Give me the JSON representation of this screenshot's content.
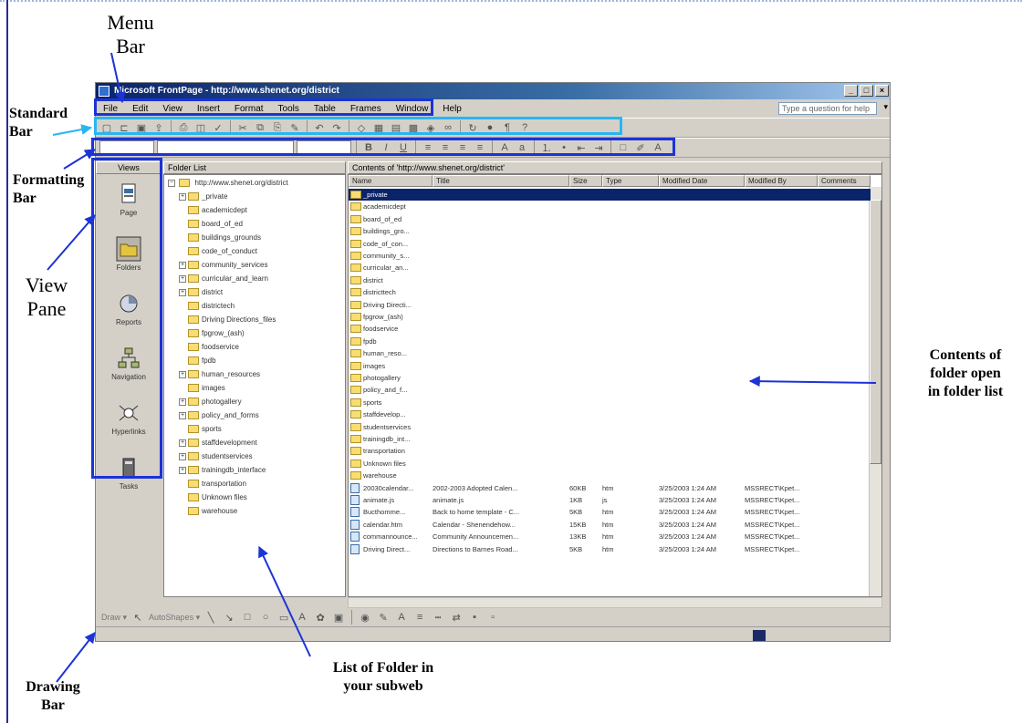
{
  "annotations": {
    "menu_bar": [
      "Menu",
      "Bar"
    ],
    "standard_bar": [
      "Standard",
      "Bar"
    ],
    "formatting_bar": [
      "Formatting",
      "Bar"
    ],
    "view_pane": [
      "View",
      "Pane"
    ],
    "contents": [
      "Contents of",
      "folder open",
      "in folder list"
    ],
    "folder_list": [
      "List of Folder in",
      "your subweb"
    ],
    "drawing_bar": [
      "Drawing",
      "Bar"
    ]
  },
  "window": {
    "title": "Microsoft FrontPage - http://www.shenet.org/district",
    "help_placeholder": "Type a question for help"
  },
  "menu": [
    "File",
    "Edit",
    "View",
    "Insert",
    "Format",
    "Tools",
    "Table",
    "Frames",
    "Window",
    "Help"
  ],
  "headers": {
    "views": "Views",
    "folder_list": "Folder List",
    "contents": "Contents of 'http://www.shenet.org/district'"
  },
  "views": [
    "Page",
    "Folders",
    "Reports",
    "Navigation",
    "Hyperlinks",
    "Tasks"
  ],
  "folder_tree": {
    "root": "http://www.shenet.org/district",
    "items": [
      {
        "name": "_private",
        "expander": true
      },
      {
        "name": "academicdept",
        "expander": false
      },
      {
        "name": "board_of_ed",
        "expander": false
      },
      {
        "name": "buildings_grounds",
        "expander": false
      },
      {
        "name": "code_of_conduct",
        "expander": false
      },
      {
        "name": "community_services",
        "expander": true
      },
      {
        "name": "curricular_and_learn",
        "expander": true
      },
      {
        "name": "district",
        "expander": true
      },
      {
        "name": "districtech",
        "expander": false
      },
      {
        "name": "Driving Directions_files",
        "expander": false
      },
      {
        "name": "fpgrow_(ash)",
        "expander": false
      },
      {
        "name": "foodservice",
        "expander": false
      },
      {
        "name": "fpdb",
        "expander": false
      },
      {
        "name": "human_resources",
        "expander": true
      },
      {
        "name": "images",
        "expander": false
      },
      {
        "name": "photogallery",
        "expander": true
      },
      {
        "name": "policy_and_forms",
        "expander": true
      },
      {
        "name": "sports",
        "expander": false
      },
      {
        "name": "staffdevelopment",
        "expander": true
      },
      {
        "name": "studentservices",
        "expander": true
      },
      {
        "name": "trainingdb_interface",
        "expander": true
      },
      {
        "name": "transportation",
        "expander": false
      },
      {
        "name": "Unknown files",
        "expander": false
      },
      {
        "name": "warehouse",
        "expander": false
      }
    ]
  },
  "contents": {
    "columns": [
      "Name",
      "Title",
      "Size",
      "Type",
      "Modified Date",
      "Modified By",
      "Comments"
    ],
    "folders": [
      "_private",
      "academicdept",
      "board_of_ed",
      "buildings_gro...",
      "code_of_con...",
      "community_s...",
      "curricular_an...",
      "district",
      "districttech",
      "Driving Directi...",
      "fpgrow_(ash)",
      "foodservice",
      "fpdb",
      "human_reso...",
      "images",
      "photogallery",
      "policy_and_f...",
      "sports",
      "staffdevelop...",
      "studentservices",
      "trainingdb_int...",
      "transportation",
      "Unknown files",
      "warehouse"
    ],
    "files": [
      {
        "name": "20030calendar...",
        "title": "2002-2003 Adopted Calen...",
        "size": "60KB",
        "type": "htm",
        "date": "3/25/2003 1:24 AM",
        "by": "MSSRECT\\Kpet..."
      },
      {
        "name": "animate.js",
        "title": "animate.js",
        "size": "1KB",
        "type": "js",
        "date": "3/25/2003 1:24 AM",
        "by": "MSSRECT\\Kpet..."
      },
      {
        "name": "Bucthomme...",
        "title": "Back to home template - C...",
        "size": "5KB",
        "type": "htm",
        "date": "3/25/2003 1:24 AM",
        "by": "MSSRECT\\Kpet..."
      },
      {
        "name": "calendar.htm",
        "title": "Calendar - Shenendehow...",
        "size": "15KB",
        "type": "htm",
        "date": "3/25/2003 1:24 AM",
        "by": "MSSRECT\\Kpet..."
      },
      {
        "name": "commannounce...",
        "title": "Community Announcemen...",
        "size": "13KB",
        "type": "htm",
        "date": "3/25/2003 1:24 AM",
        "by": "MSSRECT\\Kpet..."
      },
      {
        "name": "Driving Direct...",
        "title": "Directions to Barnes Road...",
        "size": "5KB",
        "type": "htm",
        "date": "3/25/2003 1:24 AM",
        "by": "MSSRECT\\Kpet..."
      }
    ]
  },
  "drawbar": {
    "draw_label": "Draw ▾",
    "autoshapes_label": "AutoShapes ▾"
  },
  "colors": {
    "highlight_blue": "#1c33d6",
    "highlight_cyan": "#29b6f0",
    "selection": "#0a246a"
  }
}
